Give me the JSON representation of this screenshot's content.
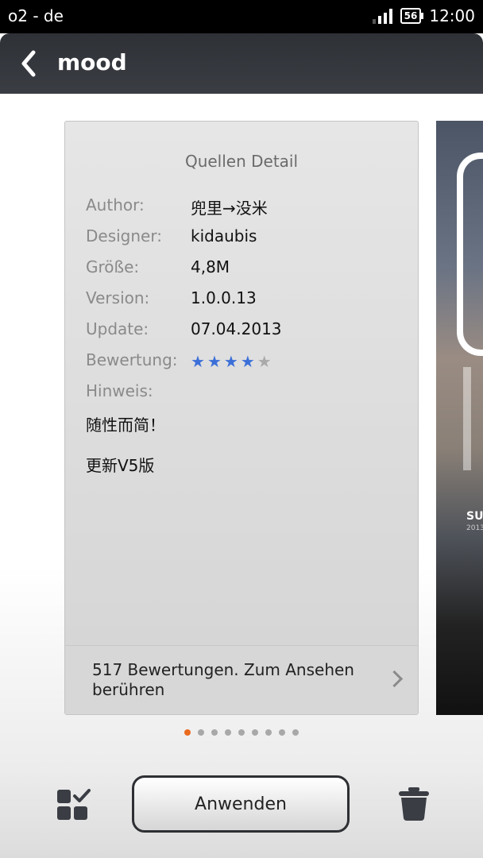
{
  "status_bar": {
    "carrier": "o2 - de",
    "battery": "56",
    "time": "12:00"
  },
  "title_bar": {
    "title": "mood",
    "back_icon": "chevron-left-icon"
  },
  "card": {
    "title": "Quellen Detail",
    "rows": [
      {
        "label": "Author:",
        "value": "兜里→没米"
      },
      {
        "label": "Designer:",
        "value": "kidaubis"
      },
      {
        "label": "Größe:",
        "value": "4,8M"
      },
      {
        "label": "Version:",
        "value": "1.0.0.13"
      },
      {
        "label": "Update:",
        "value": "07.04.2013"
      }
    ],
    "rating_label": "Bewertung:",
    "rating": 4,
    "rating_max": 5,
    "note_label": "Hinweis:",
    "note_lines": [
      "随性而简！",
      "更新V5版"
    ],
    "reviews_text": "517 Bewertungen. Zum Ansehen berühren"
  },
  "preview": {
    "text": "SU",
    "subtext": "2013"
  },
  "pager": {
    "count": 9,
    "active": 0,
    "active_color": "#ea6a1e"
  },
  "bottom_bar": {
    "apply_label": "Anwenden",
    "left_icon": "grid-check-icon",
    "right_icon": "trash-icon"
  }
}
